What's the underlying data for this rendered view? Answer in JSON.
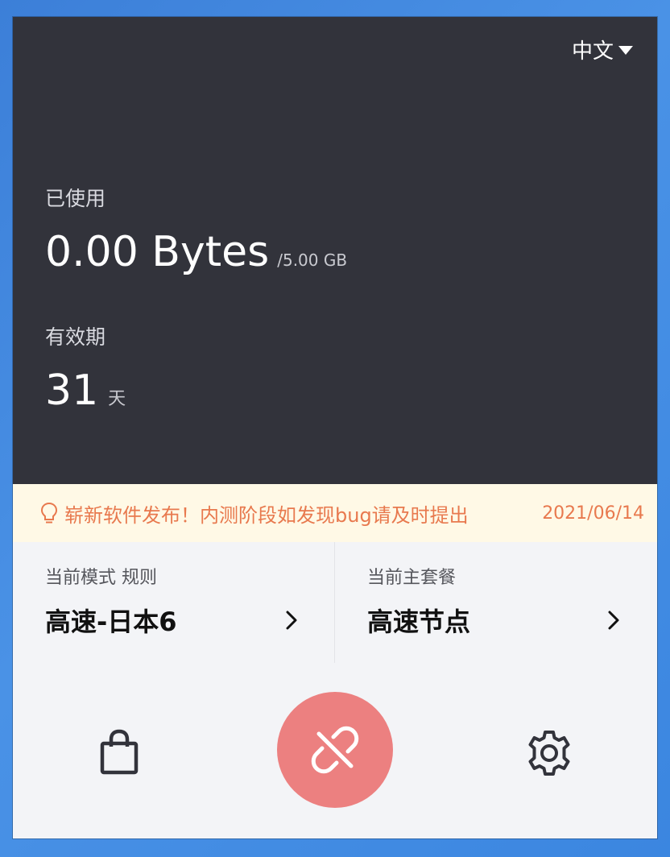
{
  "header": {
    "language_label": "中文"
  },
  "usage": {
    "label": "已使用",
    "used": "0.00 Bytes",
    "total": "/5.00 GB"
  },
  "expiry": {
    "label": "有效期",
    "days": "31",
    "unit": "天"
  },
  "notice": {
    "icon": "lightbulb-icon",
    "text": "崭新软件发布！内测阶段如发现bug请及时提出",
    "date": "2021/06/14"
  },
  "mode_card": {
    "title": "当前模式 规则",
    "value": "高速-日本6"
  },
  "plan_card": {
    "title": "当前主套餐",
    "value": "高速节点"
  },
  "bottom_bar": {
    "shop_icon": "shopping-bag-icon",
    "connect_icon": "link-broken-icon",
    "settings_icon": "gear-icon"
  },
  "colors": {
    "panel": "#32333b",
    "notice_bg": "#fff9e6",
    "notice_text": "#e8794e",
    "connect_button": "#ec8080"
  }
}
